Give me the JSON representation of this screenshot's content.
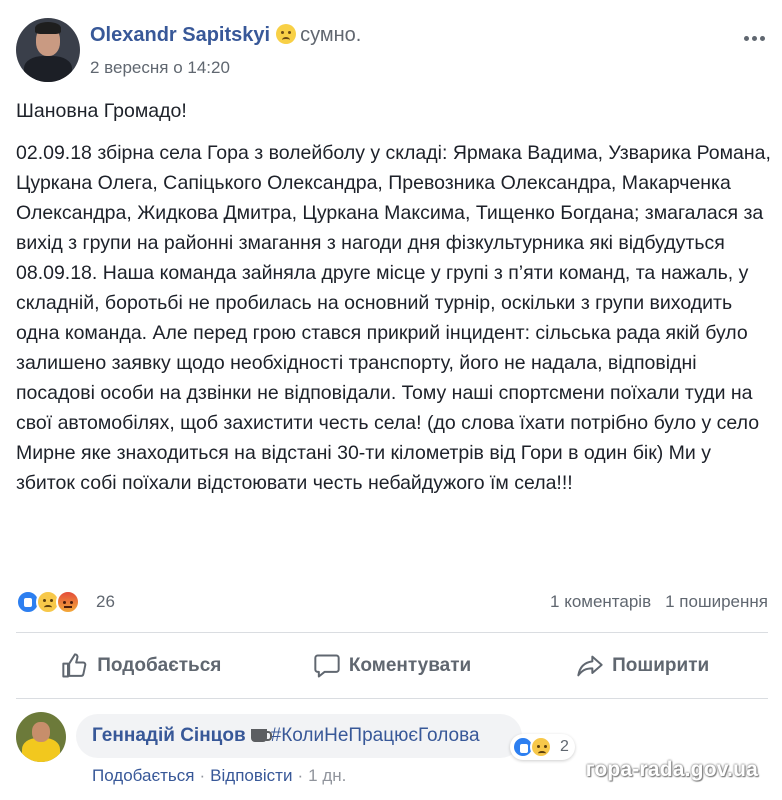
{
  "post": {
    "author": "Olexandr Sapitskyi",
    "feeling_icon": "sad-face-icon",
    "feeling": "сумно.",
    "timestamp": "2 вересня о 14:20",
    "body_paragraphs": [
      "Шановна Громадо!",
      "02.09.18 збірна села Гора з волейболу у складі: Ярмака Вадима, Узварика Романа, Цуркана Олега, Сапіцького Олександра, Превозника Олександра, Макарченка Олександра, Жидкова Дмитра, Цуркана Максима, Тищенко Богдана; змагалася за вихід з групи на районні змагання з нагоди дня фізкультурника які відбудуться 08.09.18. Наша команда зайняла друге місце у групі з п’яти команд, та нажаль, у складній, боротьбі не пробилась на основний турнір, оскільки з групи виходить одна команда. Але перед грою стався прикрий інцидент: сільська рада якій було залишено заявку щодо необхідності транспорту, його не надала, відповідні посадові особи на дзвінки не відповідали. Тому наші спортсмени поїхали туди на свої автомобілях, щоб захистити честь села! (до слова їхати потрібно було у село Мирне яке знаходиться на відстані 30-ти кілометрів від Гори в один бік) Ми у збиток собі поїхали відстоювати честь небайдужого їм села!!!"
    ]
  },
  "stats": {
    "reaction_icons": [
      "like-reaction-icon",
      "sad-reaction-icon",
      "angry-reaction-icon"
    ],
    "reaction_count": "26",
    "comments": "1 коментарів",
    "shares": "1 поширення"
  },
  "actions": {
    "like": "Подобається",
    "comment": "Коментувати",
    "share": "Поширити"
  },
  "comment": {
    "author": "Геннадій Сінцов",
    "hashtag": "#КолиНеПрацюєГолова",
    "reaction_count": "2",
    "like_link": "Подобається",
    "reply_link": "Відповісти",
    "separator": "·",
    "time": "1 дн."
  },
  "watermark": "гора-rada.gov.ua",
  "colors": {
    "link_blue": "#385898",
    "secondary_text": "#606770",
    "divider": "#dadde1",
    "like_blue": "#2d7ff0",
    "sad_yellow": "#f7c84a",
    "angry_red": "#e44d3a"
  }
}
